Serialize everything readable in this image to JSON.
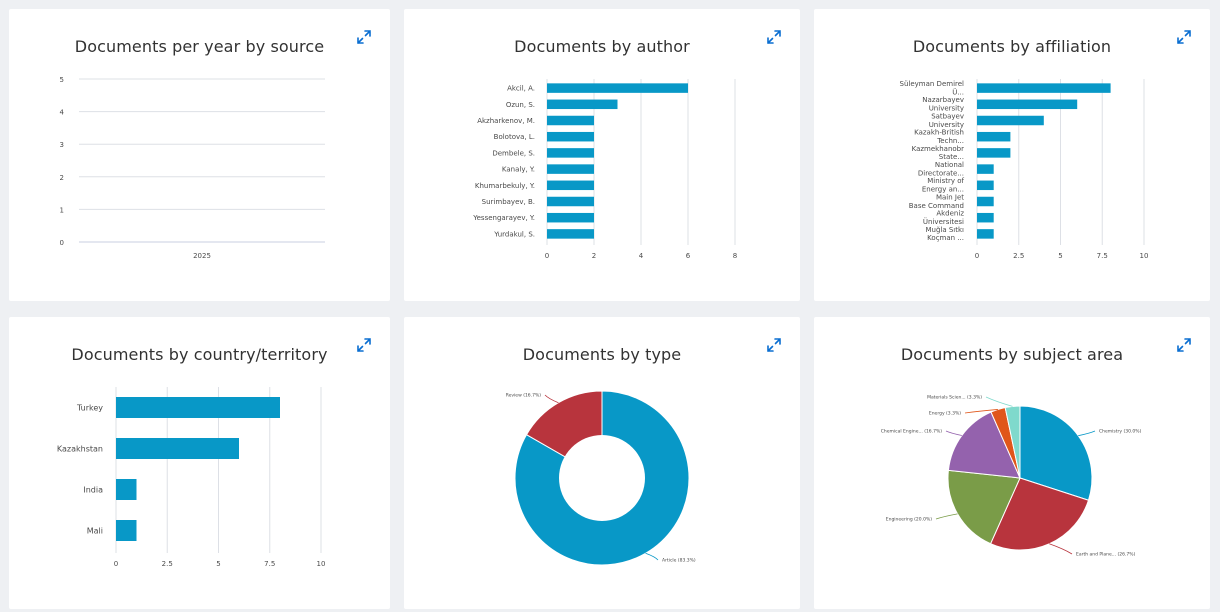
{
  "cards": {
    "per_year": {
      "title": "Documents per year by source"
    },
    "by_author": {
      "title": "Documents by author"
    },
    "by_affiliation": {
      "title": "Documents by affiliation"
    },
    "by_country": {
      "title": "Documents by country/territory"
    },
    "by_type": {
      "title": "Documents by type"
    },
    "by_subject": {
      "title": "Documents by subject area"
    }
  },
  "icons": {
    "expand": "expand-icon"
  },
  "colors": {
    "bar": "#0898c7",
    "grid": "#dde0e6",
    "icon": "#0a6ed1"
  },
  "chart_data": [
    {
      "id": "per_year",
      "type": "line",
      "title": "Documents per year by source",
      "x": [
        "2025"
      ],
      "series": [],
      "yticks": [
        0,
        1,
        2,
        3,
        4,
        5
      ],
      "ylim": [
        0,
        5
      ],
      "grid": true
    },
    {
      "id": "by_author",
      "type": "bar",
      "orientation": "horizontal",
      "title": "Documents by author",
      "categories": [
        "Akcil, A.",
        "Ozun, S.",
        "Akzharkenov, M.",
        "Bolotova, L.",
        "Dembele, S.",
        "Kanaly, Y.",
        "Khumarbekuly, Y.",
        "Surimbayev, B.",
        "Yessengarayev, Y.",
        "Yurdakul, S."
      ],
      "values": [
        6,
        3,
        2,
        2,
        2,
        2,
        2,
        2,
        2,
        2
      ],
      "xticks": [
        0,
        2,
        4,
        6,
        8
      ],
      "xlim": [
        0,
        8
      ],
      "grid": true
    },
    {
      "id": "by_affiliation",
      "type": "bar",
      "orientation": "horizontal",
      "title": "Documents by affiliation",
      "categories": [
        "Süleyman Demirel Ü...",
        "Nazarbayev University",
        "Satbayev University",
        "Kazakh-British Techn...",
        "Kazmekhanobr State...",
        "National Directorate...",
        "Ministry of Energy an...",
        "Main Jet Base Command",
        "Akdeniz Üniversitesi",
        "Muğla Sıtkı Koçman ..."
      ],
      "values": [
        8,
        6,
        4,
        2,
        2,
        1,
        1,
        1,
        1,
        1
      ],
      "xticks": [
        "0",
        "2.5",
        "5",
        "7.5",
        "10"
      ],
      "xlim": [
        0,
        10
      ],
      "grid": true
    },
    {
      "id": "by_country",
      "type": "bar",
      "orientation": "horizontal",
      "title": "Documents by country/territory",
      "categories": [
        "Turkey",
        "Kazakhstan",
        "India",
        "Mali"
      ],
      "values": [
        8,
        6,
        1,
        1
      ],
      "xticks": [
        "0",
        "2.5",
        "5",
        "7.5",
        "10"
      ],
      "xlim": [
        0,
        10
      ],
      "grid": true
    },
    {
      "id": "by_type",
      "type": "pie",
      "donut": true,
      "title": "Documents by type",
      "slices": [
        {
          "label": "Article (83.3%)",
          "value": 83.3,
          "color": "#0898c7"
        },
        {
          "label": "Review (16.7%)",
          "value": 16.7,
          "color": "#b8343d"
        }
      ]
    },
    {
      "id": "by_subject",
      "type": "pie",
      "title": "Documents by subject area",
      "slices": [
        {
          "label": "Chemistry (30.0%)",
          "value": 30.0,
          "color": "#0898c7"
        },
        {
          "label": "Earth and Plane... (26.7%)",
          "value": 26.7,
          "color": "#b8343d"
        },
        {
          "label": "Engineering (20.0%)",
          "value": 20.0,
          "color": "#7a9c48"
        },
        {
          "label": "Chemical Engine... (16.7%)",
          "value": 16.7,
          "color": "#9462ad"
        },
        {
          "label": "Energy (3.3%)",
          "value": 3.3,
          "color": "#e0561a"
        },
        {
          "label": "Materials Scien... (3.3%)",
          "value": 3.3,
          "color": "#7fd9cc"
        }
      ]
    }
  ]
}
